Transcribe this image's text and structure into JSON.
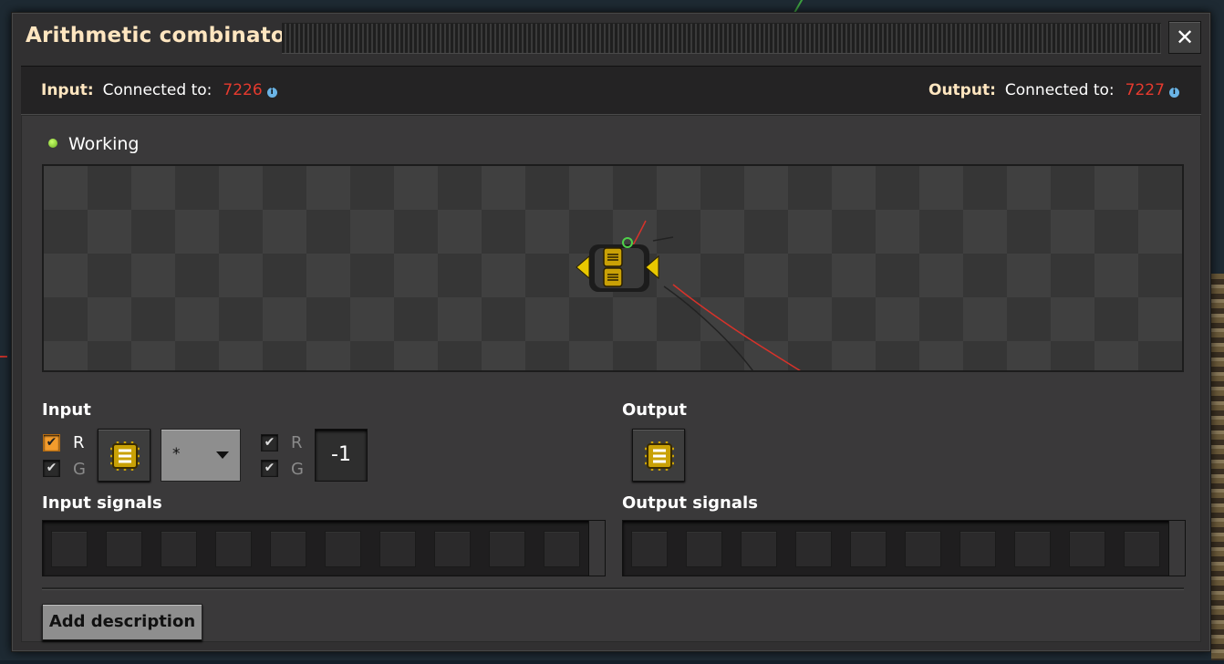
{
  "window": {
    "title": "Arithmetic combinator",
    "close_label": "✕"
  },
  "connections": {
    "input": {
      "label": "Input:",
      "text": "Connected to:",
      "network_id": "7226"
    },
    "output": {
      "label": "Output:",
      "text": "Connected to:",
      "network_id": "7227"
    },
    "info_glyph": "i"
  },
  "status": {
    "text": "Working",
    "color": "#7ec832"
  },
  "input": {
    "label": "Input",
    "red_label": "R",
    "green_label": "G",
    "left_red_checked": true,
    "left_green_checked": true,
    "left_signal_icon": "signal-each-chip-icon",
    "operator": "*",
    "right_red_label": "R",
    "right_green_label": "G",
    "right_red_checked": true,
    "right_green_checked": true,
    "constant": "-1",
    "check_glyph": "✔"
  },
  "output": {
    "label": "Output",
    "signal_icon": "signal-each-chip-icon"
  },
  "signals": {
    "input_label": "Input signals",
    "output_label": "Output signals"
  },
  "description_button": "Add description",
  "colors": {
    "title": "#ffe6c0",
    "network_id": "#e63a2e",
    "info": "#6ab4e6",
    "checkbox_orange": "#f39c2c",
    "chip": "#c9a106"
  }
}
